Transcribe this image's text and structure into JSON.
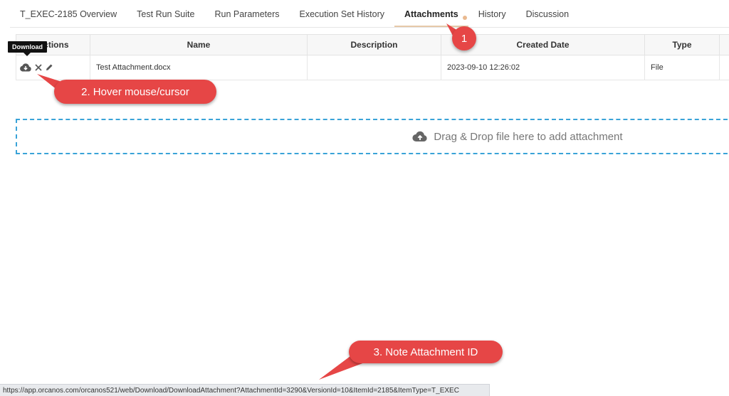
{
  "tabs": [
    {
      "label": "T_EXEC-2185 Overview"
    },
    {
      "label": "Test Run Suite"
    },
    {
      "label": "Run Parameters"
    },
    {
      "label": "Execution Set History"
    },
    {
      "label": "Attachments"
    },
    {
      "label": "History"
    },
    {
      "label": "Discussion"
    }
  ],
  "table": {
    "headers": {
      "actions": "Actions",
      "name": "Name",
      "description": "Description",
      "created_date": "Created Date",
      "type": "Type"
    },
    "rows": [
      {
        "name": "Test Attachment.docx",
        "description": "",
        "created_date": "2023-09-10 12:26:02",
        "type": "File"
      }
    ]
  },
  "tooltip": {
    "text": "Download"
  },
  "dropzone": {
    "text": "Drag & Drop file here to add attachment",
    "icon": "cloud-upload-icon"
  },
  "callouts": {
    "step1": "1",
    "step2": "2. Hover mouse/cursor",
    "step3": "3. Note Attachment ID"
  },
  "statusbar": {
    "url": "https://app.orcanos.com/orcanos521/web/Download/DownloadAttachment?AttachmentId=3290&VersionId=10&ItemId=2185&ItemType=T_EXEC"
  },
  "colors": {
    "callout": "#e64646",
    "dropzone_border": "#3aa3d8",
    "active_tab_underline": "#e6c9a8",
    "tab_dot": "#e9b98f"
  }
}
